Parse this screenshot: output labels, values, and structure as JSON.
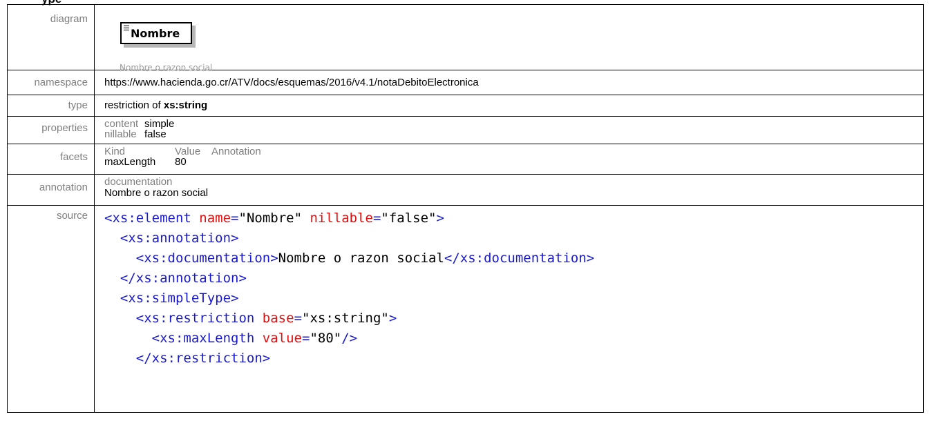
{
  "page": {
    "title": "ype"
  },
  "rows": {
    "diagram": {
      "label": "diagram",
      "element_name": "Nombre",
      "caption": "Nombre o razon social"
    },
    "namespace": {
      "label": "namespace",
      "value": "https://www.hacienda.go.cr/ATV/docs/esquemas/2016/v4.1/notaDebitoElectronica"
    },
    "type": {
      "label": "type",
      "prefix": "restriction of ",
      "base": "xs:string"
    },
    "properties": {
      "label": "properties",
      "items": [
        {
          "key": "content",
          "value": "simple"
        },
        {
          "key": "nillable",
          "value": "false"
        }
      ]
    },
    "facets": {
      "label": "facets",
      "headers": [
        "Kind",
        "Value",
        "Annotation"
      ],
      "rows": [
        {
          "kind": "maxLength",
          "value": "80",
          "annotation": ""
        }
      ]
    },
    "annotation": {
      "label": "annotation",
      "heading": "documentation",
      "text": "Nombre o razon social"
    },
    "source": {
      "label": "source",
      "lines": [
        {
          "indent": "",
          "parts": [
            {
              "c": "t",
              "v": "<xs:element "
            },
            {
              "c": "a",
              "v": "name"
            },
            {
              "c": "t",
              "v": "="
            },
            {
              "c": "s",
              "v": "\"Nombre\""
            },
            {
              "c": "a",
              "v": " nillable"
            },
            {
              "c": "t",
              "v": "="
            },
            {
              "c": "s",
              "v": "\"false\""
            },
            {
              "c": "t",
              "v": ">"
            }
          ]
        },
        {
          "indent": "  ",
          "parts": [
            {
              "c": "t",
              "v": "<xs:annotation>"
            }
          ]
        },
        {
          "indent": "    ",
          "parts": [
            {
              "c": "t",
              "v": "<xs:documentation>"
            },
            {
              "c": "tx",
              "v": "Nombre o razon social"
            },
            {
              "c": "t",
              "v": "</xs:documentation>"
            }
          ]
        },
        {
          "indent": "  ",
          "parts": [
            {
              "c": "t",
              "v": "</xs:annotation>"
            }
          ]
        },
        {
          "indent": "  ",
          "parts": [
            {
              "c": "t",
              "v": "<xs:simpleType>"
            }
          ]
        },
        {
          "indent": "    ",
          "parts": [
            {
              "c": "t",
              "v": "<xs:restriction "
            },
            {
              "c": "a",
              "v": "base"
            },
            {
              "c": "t",
              "v": "="
            },
            {
              "c": "s",
              "v": "\"xs:string\""
            },
            {
              "c": "t",
              "v": ">"
            }
          ]
        },
        {
          "indent": "      ",
          "parts": [
            {
              "c": "t",
              "v": "<xs:maxLength "
            },
            {
              "c": "a",
              "v": "value"
            },
            {
              "c": "t",
              "v": "="
            },
            {
              "c": "s",
              "v": "\"80\""
            },
            {
              "c": "t",
              "v": "/>"
            }
          ]
        },
        {
          "indent": "    ",
          "parts": [
            {
              "c": "t",
              "v": "</xs:restriction>"
            }
          ]
        }
      ]
    }
  }
}
